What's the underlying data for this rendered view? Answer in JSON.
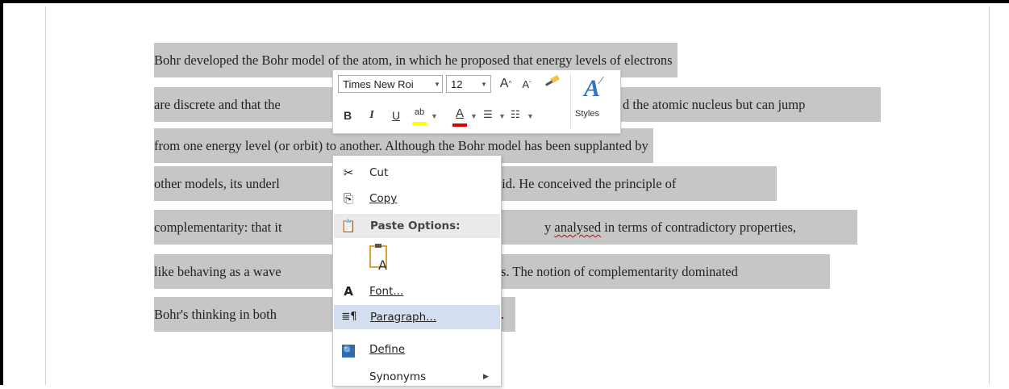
{
  "document": {
    "lines": [
      "Bohr developed the Bohr model of the atom, in which he proposed that energy levels of electrons",
      "are discrete and that the",
      "from one energy level (or orbit) to another. Although the Bohr model has been supplanted by",
      "other models, its underl",
      "complementarity: that it",
      "like behaving as a wave",
      "Bohr's thinking in both"
    ],
    "line2_tail": "d the atomic nucleus but can jump",
    "line4_tail": "valid. He conceived the principle of",
    "line5_tail_pre": "y ",
    "line5_misspelled": "analysed",
    "line5_tail_post": " in terms of contradictory properties,",
    "line6_tail": "s. The notion of complementarity dominated",
    "line7_tail": "."
  },
  "mini_toolbar": {
    "font_name": "Times New Roi",
    "font_size": "12",
    "grow_font": "A",
    "shrink_font": "A",
    "bold": "B",
    "italic": "I",
    "underline": "U",
    "highlight": "ab",
    "font_color": "A",
    "styles_label": "Styles",
    "highlight_color": "#ffff00",
    "font_color_value": "#e00000"
  },
  "context_menu": {
    "cut": "Cut",
    "copy": "Copy",
    "paste_options": "Paste Options:",
    "font": "Font...",
    "paragraph": "Paragraph...",
    "define": "Define",
    "synonyms": "Synonyms"
  }
}
